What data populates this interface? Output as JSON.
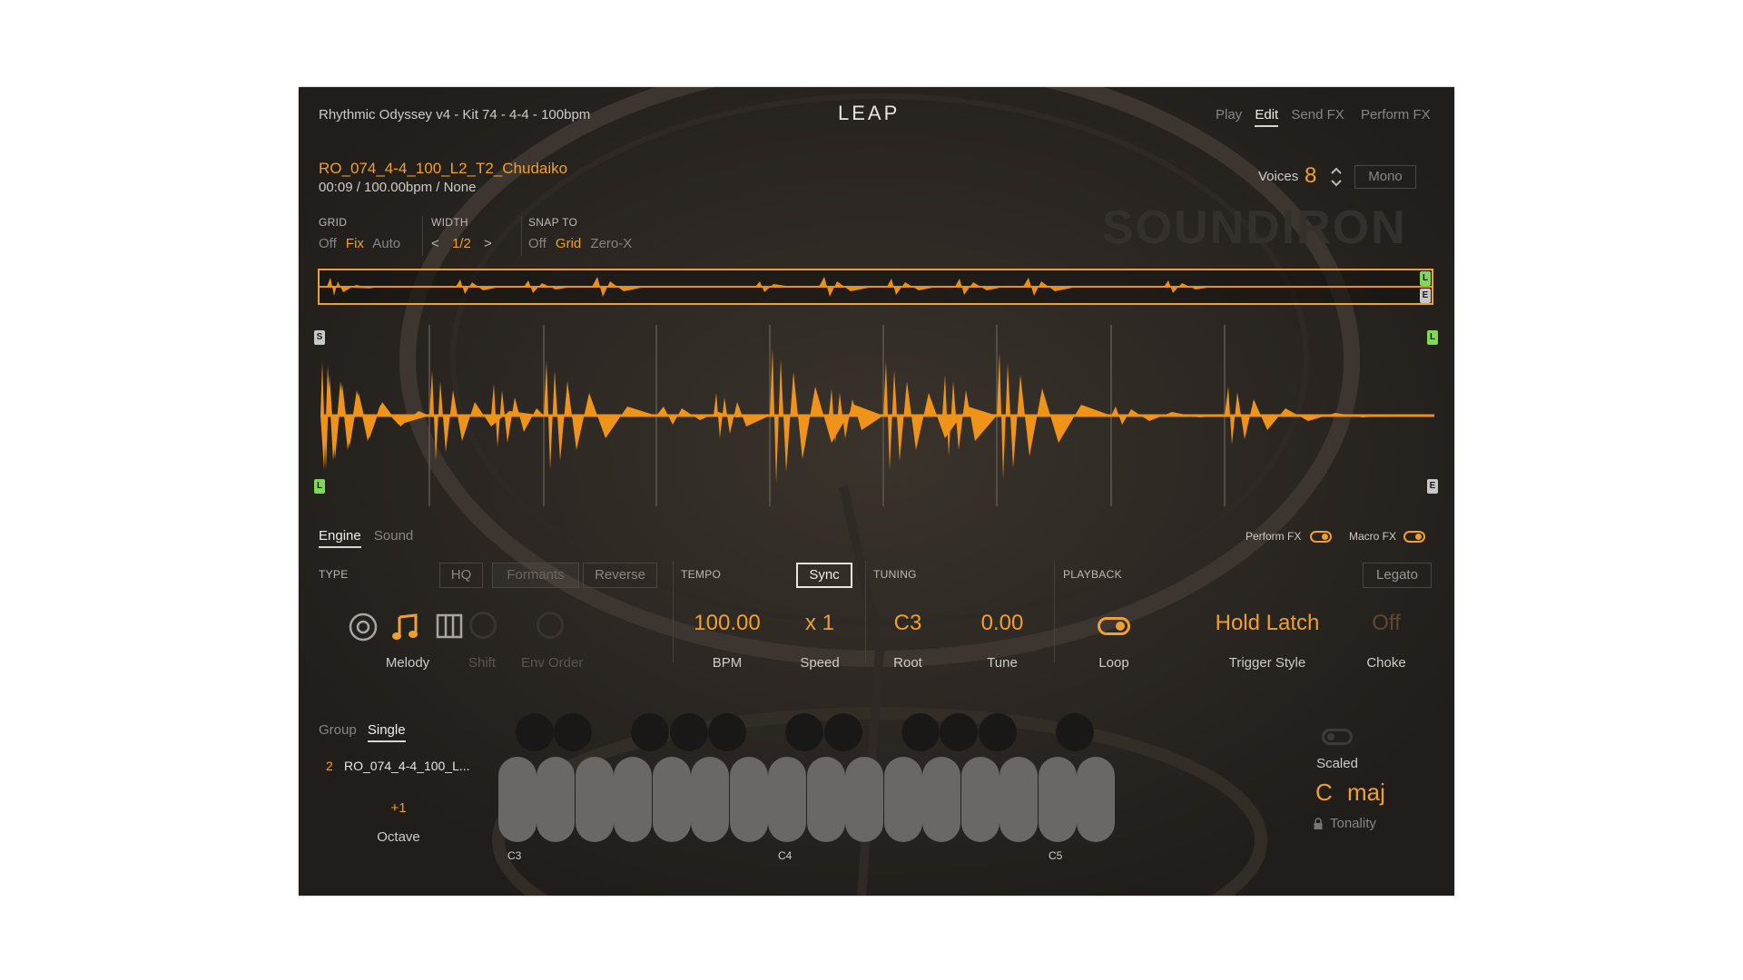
{
  "header": {
    "kit_title": "Rhythmic Odyssey v4 - Kit 74 - 4-4 - 100bpm",
    "logo": "LEAP",
    "tabs": [
      {
        "label": "Play"
      },
      {
        "label": "Edit"
      },
      {
        "label": "Send FX"
      },
      {
        "label": "Perform FX"
      }
    ],
    "active_tab": "Edit"
  },
  "sample": {
    "name": "RO_074_4-4_100_L2_T2_Chudaiko",
    "info": "00:09 / 100.00bpm / None"
  },
  "voices": {
    "label": "Voices",
    "value": "8",
    "mono_label": "Mono"
  },
  "watermark": "SOUNDIRON",
  "grid": {
    "label": "GRID",
    "options": [
      "Off",
      "Fix",
      "Auto"
    ],
    "selected": "Fix"
  },
  "width": {
    "label": "WIDTH",
    "value": "1/2",
    "prev": "<",
    "next": ">"
  },
  "snap": {
    "label": "SNAP TO",
    "options": [
      "Off",
      "Grid",
      "Zero-X"
    ],
    "selected": "Grid"
  },
  "markers": {
    "start": "S",
    "loop": "L",
    "end": "E"
  },
  "bottom_tabs": {
    "engine": "Engine",
    "sound": "Sound",
    "active": "Engine"
  },
  "fx_toggles": {
    "perform_fx": "Perform FX",
    "macro_fx": "Macro FX"
  },
  "type_section": {
    "label": "TYPE",
    "hq": "HQ",
    "formants": "Formants",
    "reverse": "Reverse",
    "icons": [
      "circle-icon",
      "music-note-icon",
      "slices-icon"
    ],
    "mode": "Melody",
    "shift": "Shift",
    "env_order": "Env Order"
  },
  "tempo_section": {
    "label": "TEMPO",
    "sync": "Sync",
    "bpm_value": "100.00",
    "bpm_label": "BPM",
    "speed_value": "x 1",
    "speed_label": "Speed"
  },
  "tuning_section": {
    "label": "TUNING",
    "root_value": "C3",
    "root_label": "Root",
    "tune_value": "0.00",
    "tune_label": "Tune"
  },
  "playback_section": {
    "label": "PLAYBACK",
    "legato": "Legato",
    "loop_label": "Loop",
    "trigger_value": "Hold Latch",
    "trigger_label": "Trigger Style",
    "choke_value": "Off",
    "choke_label": "Choke"
  },
  "group_section": {
    "group": "Group",
    "single": "Single",
    "active": "Single",
    "item_index": "2",
    "item_name": "RO_074_4-4_100_L...",
    "octave_value": "+1",
    "octave_label": "Octave"
  },
  "keyboard": {
    "labels": [
      "C3",
      "C4",
      "C5"
    ]
  },
  "scale_section": {
    "scaled_label": "Scaled",
    "key": "C",
    "mode": "maj",
    "tonality_label": "Tonality"
  },
  "colors": {
    "accent": "#f0a030",
    "panel": "#272421",
    "loop_marker": "#7ed957",
    "end_marker": "#c8c8c8"
  }
}
